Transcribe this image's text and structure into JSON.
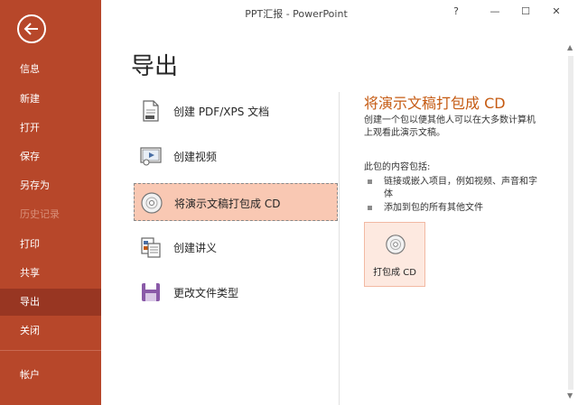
{
  "window": {
    "title": "PPT汇报 - PowerPoint",
    "help": "?",
    "minimize": "—",
    "maximize": "☐",
    "close": "✕"
  },
  "sidebar": {
    "items": [
      {
        "label": "信息"
      },
      {
        "label": "新建"
      },
      {
        "label": "打开"
      },
      {
        "label": "保存"
      },
      {
        "label": "另存为"
      },
      {
        "label": "历史记录",
        "disabled": true
      },
      {
        "label": "打印"
      },
      {
        "label": "共享"
      },
      {
        "label": "导出",
        "active": true
      },
      {
        "label": "关闭"
      },
      {
        "label": "帐户"
      }
    ]
  },
  "main": {
    "title": "导出",
    "options": [
      {
        "label": "创建 PDF/XPS 文档",
        "icon": "pdf-document-icon"
      },
      {
        "label": "创建视频",
        "icon": "video-icon"
      },
      {
        "label": "将演示文稿打包成 CD",
        "icon": "cd-icon",
        "selected": true
      },
      {
        "label": "创建讲义",
        "icon": "handout-icon"
      },
      {
        "label": "更改文件类型",
        "icon": "file-type-icon"
      }
    ]
  },
  "detail": {
    "title": "将演示文稿打包成 CD",
    "description": "创建一个包以便其他人可以在大多数计算机上观看此演示文稿。",
    "includes_label": "此包的内容包括:",
    "bullets": [
      "链接或嵌入项目，例如视频、声音和字体",
      "添加到包的所有其他文件"
    ],
    "button_label": "打包成 CD"
  },
  "scrollbar": {
    "up": "▲",
    "down": "▼"
  },
  "colors": {
    "sidebar": "#b7472a",
    "sidebar_active": "#983622",
    "accent_text": "#c55a11",
    "selected_option": "#f9c8b3"
  }
}
